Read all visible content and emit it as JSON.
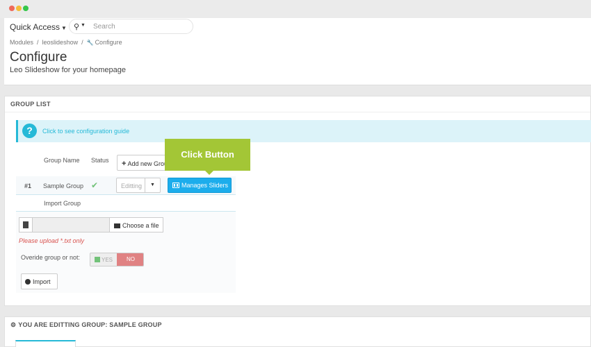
{
  "header": {
    "quick_access": "Quick Access",
    "search_placeholder": "Search",
    "breadcrumb": [
      "Modules",
      "leoslideshow",
      "Configure"
    ],
    "title": "Configure",
    "subtitle": "Leo Slideshow for your homepage"
  },
  "group_list": {
    "heading": "GROUP LIST",
    "info_text": "Click to see configuration guide",
    "col_group_name": "Group Name",
    "col_status": "Status",
    "add_new_label": "Add new Group",
    "rows": [
      {
        "id": "#1",
        "name": "Sample Group",
        "status": "✔",
        "editing": "Editting",
        "manage_label": "Manages Sliders"
      }
    ],
    "tooltip": "Click Button",
    "import": {
      "label": "Import Group",
      "choose_label": "Choose a file",
      "hint": "Please upload *.txt only",
      "override_label": "Overide group or not:",
      "yes": "YES",
      "no": "NO",
      "import_button": "Import"
    }
  },
  "editing_group": {
    "heading": "YOU ARE EDITTING GROUP: SAMPLE GROUP"
  },
  "icons": {
    "search": "search-icon",
    "question": "question-circle-icon",
    "check": "check-icon",
    "film": "film-icon",
    "file": "file-icon",
    "folder": "folder-open-icon",
    "import": "arrow-circle-icon",
    "cogs": "cogs-icon"
  },
  "colors": {
    "accent_blue": "#25b9d7",
    "manage_button": "#1cadec",
    "tooltip_green": "#a3c636",
    "status_green": "#72c279",
    "no_red": "#e08283",
    "hint_red": "#d9534f"
  }
}
